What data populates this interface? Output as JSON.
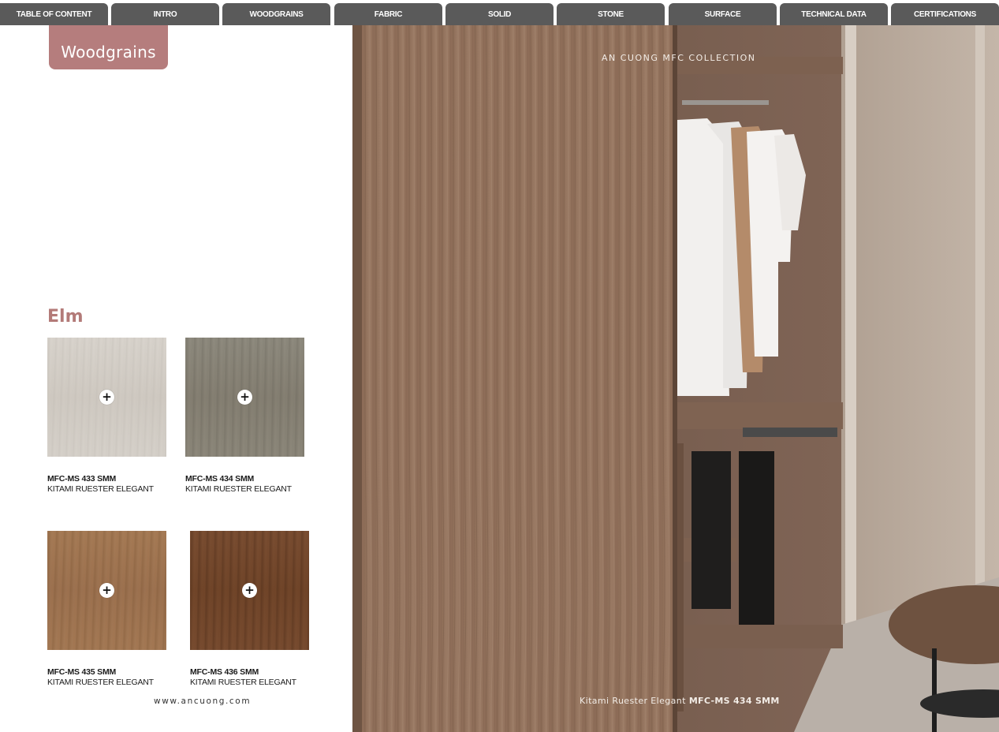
{
  "nav": {
    "tabs": [
      {
        "label": "TABLE OF CONTENT"
      },
      {
        "label": "INTRO"
      },
      {
        "label": "WOODGRAINS"
      },
      {
        "label": "FABRIC"
      },
      {
        "label": "SOLID"
      },
      {
        "label": "STONE"
      },
      {
        "label": "SURFACE"
      },
      {
        "label": "TECHNICAL DATA"
      },
      {
        "label": "CERTIFICATIONS"
      }
    ],
    "tab_color": "#5a5a5a"
  },
  "left_page": {
    "section_badge": "Woodgrains",
    "badge_color": "#b57d7d",
    "family_title": "Elm",
    "swatches": [
      {
        "code": "MFC-MS 433 SMM",
        "name": "KITAMI RUESTER ELEGANT",
        "color": "#d3cec6",
        "zoom_icon": "plus-icon"
      },
      {
        "code": "MFC-MS 434 SMM",
        "name": "KITAMI RUESTER ELEGANT",
        "color": "#8a8578",
        "zoom_icon": "plus-icon"
      },
      {
        "code": "MFC-MS 435 SMM",
        "name": "KITAMI RUESTER ELEGANT",
        "color": "#a07653",
        "zoom_icon": "plus-icon"
      },
      {
        "code": "MFC-MS 436 SMM",
        "name": "KITAMI RUESTER ELEGANT",
        "color": "#754a2e",
        "zoom_icon": "plus-icon"
      }
    ],
    "website": "www.ancuong.com"
  },
  "right_page": {
    "collection_label": "AN CUONG MFC COLLECTION",
    "caption_name": "Kitami Ruester Elegant",
    "caption_code": "MFC-MS 434 SMM"
  }
}
